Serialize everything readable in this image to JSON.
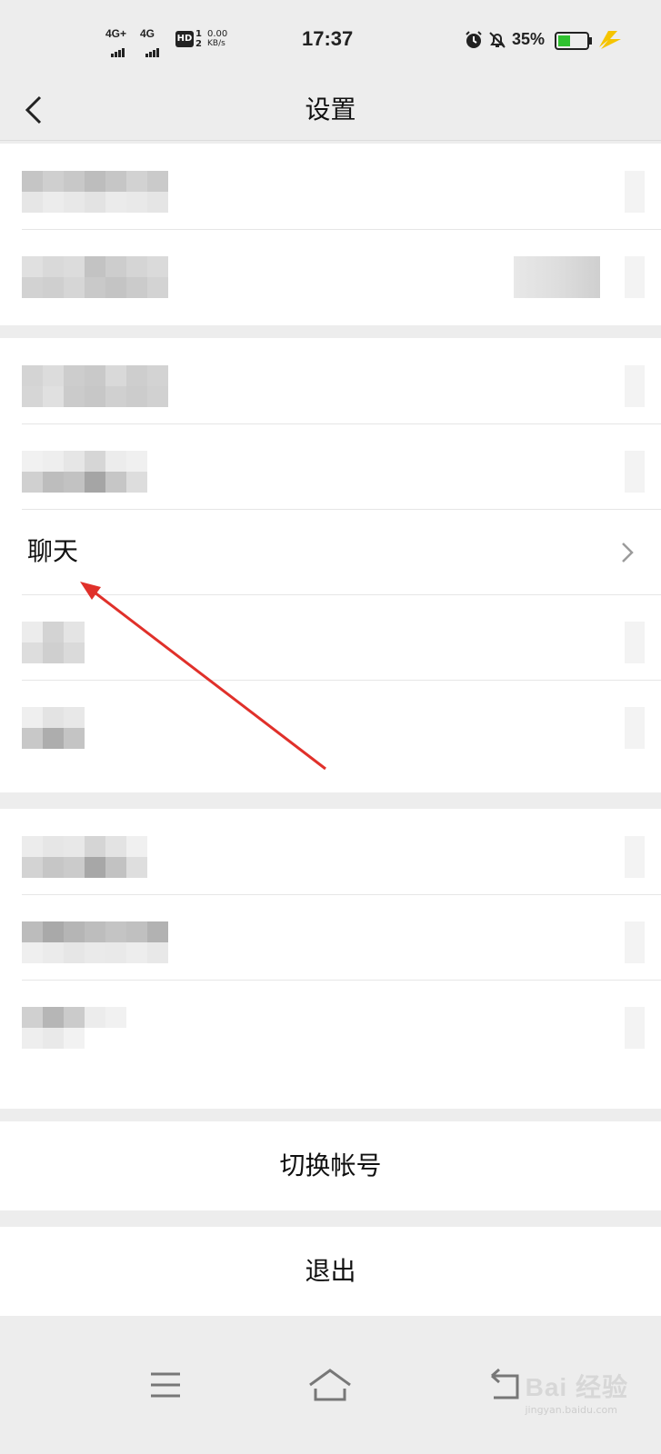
{
  "status_bar": {
    "sim1_type": "4G+",
    "sim2_type": "4G",
    "hd_badge": "HD",
    "sim_nums": "1\n2",
    "net_speed_value": "0.00",
    "net_speed_unit": "KB/s",
    "time": "17:37",
    "battery_percent": "35%",
    "icons": [
      "alarm-icon",
      "silent-bell-icon",
      "battery-icon",
      "charging-bolt-icon"
    ]
  },
  "header": {
    "title": "设置",
    "back_icon": "chevron-left-icon"
  },
  "settings": {
    "chat_label": "聊天",
    "chevron_icon": "chevron-right-icon"
  },
  "actions": {
    "switch_account": "切换帐号",
    "logout": "退出"
  },
  "navbar": {
    "icons": [
      "menu-icon",
      "home-icon",
      "back-return-icon"
    ]
  },
  "watermark": {
    "text": "Bai 经验",
    "sub": "jingyan.baidu.com"
  },
  "colors": {
    "background": "#ededed",
    "card": "#ffffff",
    "arrow": "#e0302a",
    "battery_fill": "#2fc12f",
    "charging": "#f5c400"
  }
}
